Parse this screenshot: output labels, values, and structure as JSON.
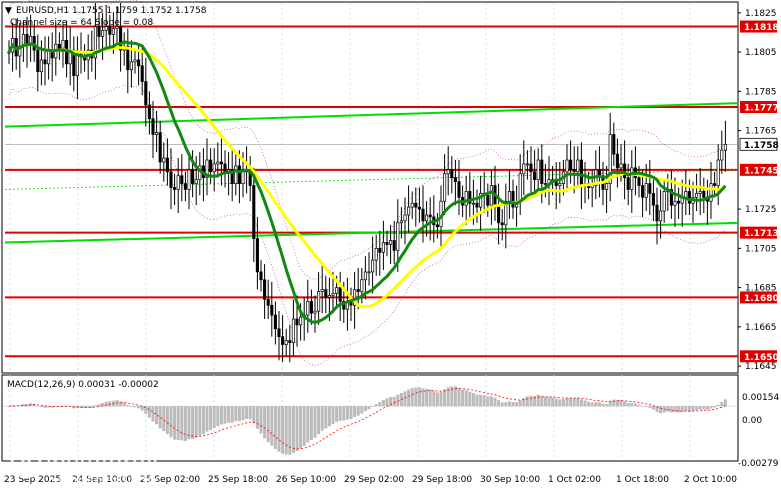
{
  "header": {
    "symbol_line": "EURUSD,H1  1.1755 1.1759 1.1752 1.1758",
    "indicator_line": "Channel size = 64  Slope = 0.08"
  },
  "macd": {
    "label": "MACD(12,26,9) 0.00031 -0.00002"
  },
  "watermark": {
    "brand": "instaforex",
    "tagline": "Instant Forex Trading"
  },
  "colors": {
    "candles": "#000000",
    "level": "#e00000",
    "ma_green": "#118811",
    "ma_yellow": "#ffff00",
    "channel": "#00dd00",
    "bands": "#cc55cc",
    "macd_hist": "#bbbbbb",
    "macd_signal": "#ff0000",
    "label_bg": "#e00000"
  },
  "chart_data": {
    "type": "candlestick",
    "title": "EURUSD,H1",
    "ylim": [
      1.1642,
      1.183
    ],
    "price_ticks": [
      {
        "label": "1.1825",
        "value": 1.1825
      },
      {
        "label": "1.1805",
        "value": 1.1805
      },
      {
        "label": "1.1785",
        "value": 1.1785
      },
      {
        "label": "1.1765",
        "value": 1.1765
      },
      {
        "label": "1.1725",
        "value": 1.1725
      },
      {
        "label": "1.1705",
        "value": 1.1705
      },
      {
        "label": "1.1685",
        "value": 1.1685
      },
      {
        "label": "1.1665",
        "value": 1.1665
      },
      {
        "label": "1.1645",
        "value": 1.1645
      }
    ],
    "levels": [
      {
        "label": "1.1818",
        "value": 1.1818
      },
      {
        "label": "1.1777",
        "value": 1.1777
      },
      {
        "label": "1.1745",
        "value": 1.1745
      },
      {
        "label": "1.1713",
        "value": 1.1713
      },
      {
        "label": "1.1680",
        "value": 1.168
      },
      {
        "label": "1.1650",
        "value": 1.165
      }
    ],
    "current_price": {
      "label": "1.1758",
      "value": 1.1758
    },
    "time_labels": [
      "23 Sep 2025",
      "24 Sep 10:00",
      "25 Sep 02:00",
      "25 Sep 18:00",
      "26 Sep 10:00",
      "29 Sep 02:00",
      "29 Sep 18:00",
      "30 Sep 10:00",
      "1 Oct 02:00",
      "1 Oct 18:00",
      "2 Oct 10:00"
    ],
    "candles_close": [
      1.1805,
      1.1812,
      1.1803,
      1.1808,
      1.1814,
      1.1809,
      1.1813,
      1.1806,
      1.1795,
      1.1801,
      1.1799,
      1.1806,
      1.1802,
      1.1809,
      1.1807,
      1.1811,
      1.1799,
      1.1806,
      1.1793,
      1.1804,
      1.1803,
      1.1801,
      1.1806,
      1.1802,
      1.1818,
      1.1813,
      1.1816,
      1.1818,
      1.1814,
      1.1817,
      1.1818,
      1.1806,
      1.1808,
      1.1796,
      1.18,
      1.1801,
      1.1798,
      1.179,
      1.1778,
      1.1771,
      1.1763,
      1.1764,
      1.1749,
      1.1751,
      1.1744,
      1.1736,
      1.1735,
      1.1742,
      1.1738,
      1.1735,
      1.1745,
      1.1738,
      1.174,
      1.1747,
      1.1741,
      1.175,
      1.1744,
      1.1748,
      1.1749,
      1.1748,
      1.1744,
      1.1745,
      1.1738,
      1.1747,
      1.1738,
      1.1744,
      1.1745,
      1.1737,
      1.171,
      1.1693,
      1.1689,
      1.1679,
      1.1676,
      1.1671,
      1.1664,
      1.166,
      1.1656,
      1.1658,
      1.1657,
      1.1669,
      1.1666,
      1.167,
      1.1671,
      1.1678,
      1.1672,
      1.1673,
      1.1683,
      1.1684,
      1.168,
      1.1681,
      1.1682,
      1.1685,
      1.1678,
      1.1674,
      1.1678,
      1.1676,
      1.1684,
      1.1683,
      1.1689,
      1.1693,
      1.1693,
      1.1699,
      1.1705,
      1.1703,
      1.1708,
      1.1707,
      1.1709,
      1.1704,
      1.1718,
      1.1719,
      1.1722,
      1.1726,
      1.1728,
      1.1726,
      1.1725,
      1.1719,
      1.1722,
      1.1721,
      1.1717,
      1.1716,
      1.1729,
      1.1743,
      1.1745,
      1.1741,
      1.1739,
      1.1731,
      1.1727,
      1.1734,
      1.1728,
      1.1728,
      1.1726,
      1.1733,
      1.1732,
      1.1727,
      1.1737,
      1.1726,
      1.1718,
      1.1717,
      1.1729,
      1.1734,
      1.1726,
      1.1729,
      1.1743,
      1.1748,
      1.1748,
      1.1744,
      1.174,
      1.175,
      1.1738,
      1.1738,
      1.174,
      1.174,
      1.1737,
      1.1738,
      1.1744,
      1.175,
      1.1745,
      1.1744,
      1.175,
      1.1737,
      1.1738,
      1.1736,
      1.1737,
      1.1745,
      1.1742,
      1.1735,
      1.1738,
      1.1763,
      1.1753,
      1.1746,
      1.1748,
      1.1741,
      1.1735,
      1.1746,
      1.1741,
      1.1737,
      1.1731,
      1.1738,
      1.1733,
      1.1727,
      1.1719,
      1.1724,
      1.1734,
      1.1735,
      1.1727,
      1.1729,
      1.1728,
      1.1731,
      1.1734,
      1.1728,
      1.1731,
      1.1733,
      1.1734,
      1.1731,
      1.1729,
      1.1738,
      1.1737,
      1.175,
      1.1755,
      1.1758
    ]
  }
}
